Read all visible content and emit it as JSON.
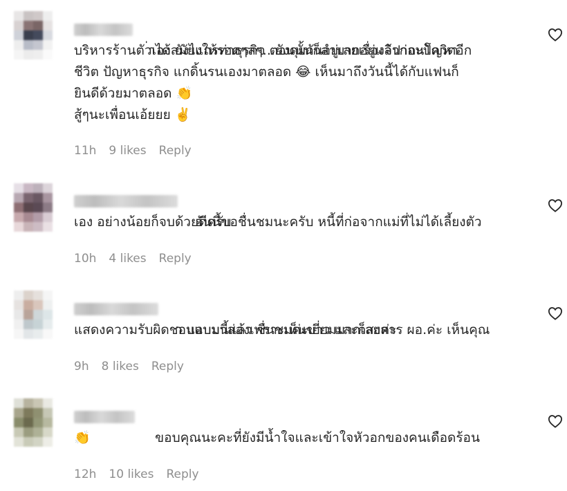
{
  "comments": [
    {
      "text_line1": "่าได้สมัยแกรท่าธุรกิจ ตอนนั้นก็ลำบากอยู่แล้วก่อนโควิดอีก",
      "text_rest": "บริหารร้านตัวเอง ยังไงให้รอดๆลๆ...ยังคุยกันอยู่เลยเรื่องจิปาถะปัญหา\nชีวิต ปัญหาธุรกิจ แกดิ้นรนเองมาตลอด 😂 เห็นมาถึงวันนี้ได้กับแฟนก็\nยินดีด้วยมาตลอด 👏\nสู้ๆนะเพื่อนเอ้ยยย ✌️",
      "time": "11h",
      "likes": "9 likes",
      "reply": "Reply"
    },
    {
      "text_line1": "อันนี้ขอชื่นชมนะครับ หนี้ที่ก่อจากแม่ที่ไม่ได้เลี้ยงตัว",
      "text_rest": "เอง อย่างน้อยก็จบด้วยดีครับ",
      "time": "10h",
      "likes": "4 likes",
      "reply": "Reply"
    },
    {
      "text_line1": "า แอบมาส่องเพราะเห็นข่าว และก็สงสาร ผอ.ค่ะ เห็นคุณ",
      "text_rest": "แสดงความรับผิดชอบแบบนี้แล้ว ชื่นชมค่ะเยี่ยมมากเลยค่ะ",
      "time": "9h",
      "likes": "8 likes",
      "reply": "Reply"
    },
    {
      "text_line1": "ขอบคุณนะคะที่ยังมีน้ำใจและเข้าใจหัวอกของคนเดือดร้อน",
      "text_rest": "👏",
      "time": "12h",
      "likes": "10 likes",
      "reply": "Reply"
    }
  ],
  "icons": {
    "like": "heart-outline-icon"
  },
  "colors": {
    "text": "#262626",
    "meta": "#8e8e8e"
  }
}
